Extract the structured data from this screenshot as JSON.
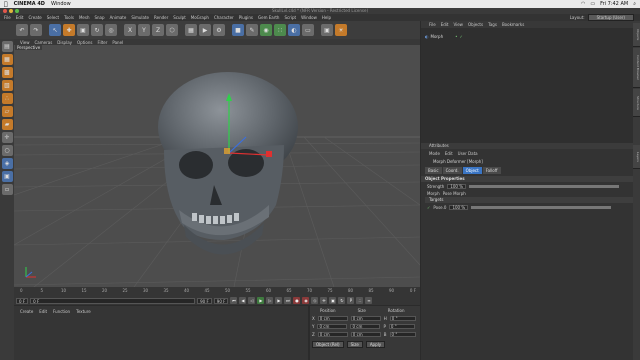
{
  "menubar": {
    "app": "CINEMA 4D",
    "items": [
      "Window"
    ],
    "right": [
      "Fri 7:42 AM"
    ]
  },
  "window_title": "SkullLvl.c4d * (NFR Version - Restricted License)",
  "app_menu": [
    "File",
    "Edit",
    "Create",
    "Select",
    "Tools",
    "Mesh",
    "Snap",
    "Animate",
    "Simulate",
    "Render",
    "Sculpt",
    "MoGraph",
    "Character",
    "Plugins",
    "Gem Earth",
    "Script",
    "Window",
    "Help"
  ],
  "layout": {
    "label": "Layout:",
    "value": "Startup (User)"
  },
  "toolbar_icons": [
    "undo-icon",
    "redo-icon",
    "select-icon",
    "move-icon",
    "scale-icon",
    "rotate-icon",
    "recent-tool-icon",
    "x-axis-icon",
    "y-axis-icon",
    "z-axis-icon",
    "coord-system-icon",
    "render-region-icon",
    "render-view-icon",
    "render-settings-icon",
    "cube-icon",
    "spline-pen-icon",
    "subdivision-icon",
    "array-icon",
    "deformer-icon",
    "floor-icon",
    "camera-icon",
    "light-icon"
  ],
  "viewport": {
    "menu": [
      "View",
      "Cameras",
      "Display",
      "Options",
      "Filter",
      "Panel"
    ],
    "label": "Perspective"
  },
  "timeline": {
    "ticks": [
      "0",
      "5",
      "10",
      "15",
      "20",
      "25",
      "30",
      "35",
      "40",
      "45",
      "50",
      "55",
      "60",
      "65",
      "70",
      "75",
      "80",
      "85",
      "90"
    ],
    "end_label": "0 F",
    "start_field": "0 F",
    "current_field": "0 F",
    "end_field": "90 F",
    "max_field": "90 F"
  },
  "material_manager": {
    "menu": [
      "Create",
      "Edit",
      "Function",
      "Texture"
    ]
  },
  "coordinates": {
    "headers": [
      "Position",
      "Size",
      "Rotation"
    ],
    "rows": [
      {
        "axis": "X",
        "pos": "0 cm",
        "size": "0 cm",
        "rot_axis": "H",
        "rot": "0 °"
      },
      {
        "axis": "Y",
        "pos": "0 cm",
        "size": "0 cm",
        "rot_axis": "P",
        "rot": "0 °"
      },
      {
        "axis": "Z",
        "pos": "0 cm",
        "size": "0 cm",
        "rot_axis": "B",
        "rot": "0 °"
      }
    ],
    "mode": "Object (Rel)",
    "size_mode": "Size",
    "apply": "Apply"
  },
  "object_manager": {
    "menu": [
      "File",
      "Edit",
      "View",
      "Objects",
      "Tags",
      "Bookmarks"
    ],
    "objects": [
      {
        "name": "Morph"
      }
    ]
  },
  "attributes": {
    "header": "Attributes",
    "menu": [
      "Mode",
      "Edit",
      "User Data"
    ],
    "title": "Morph Deformer [Morph]",
    "tabs": [
      "Basic",
      "Coord.",
      "Object",
      "Falloff"
    ],
    "active_tab": "Object",
    "section": "Object Properties",
    "strength_label": "Strength",
    "strength_value": "100 %",
    "morph_label": "Morph",
    "morph_value": "Pose Morph",
    "targets_label": "Targets",
    "pose_label": "Pose.0",
    "pose_value": "100 %"
  },
  "right_tabs": [
    "Objects",
    "Content Browser",
    "Structure",
    "Layers"
  ],
  "colors": {
    "accent": "#3a75c4",
    "viewport_bg": "#4d4d4d",
    "panel": "#333333"
  }
}
